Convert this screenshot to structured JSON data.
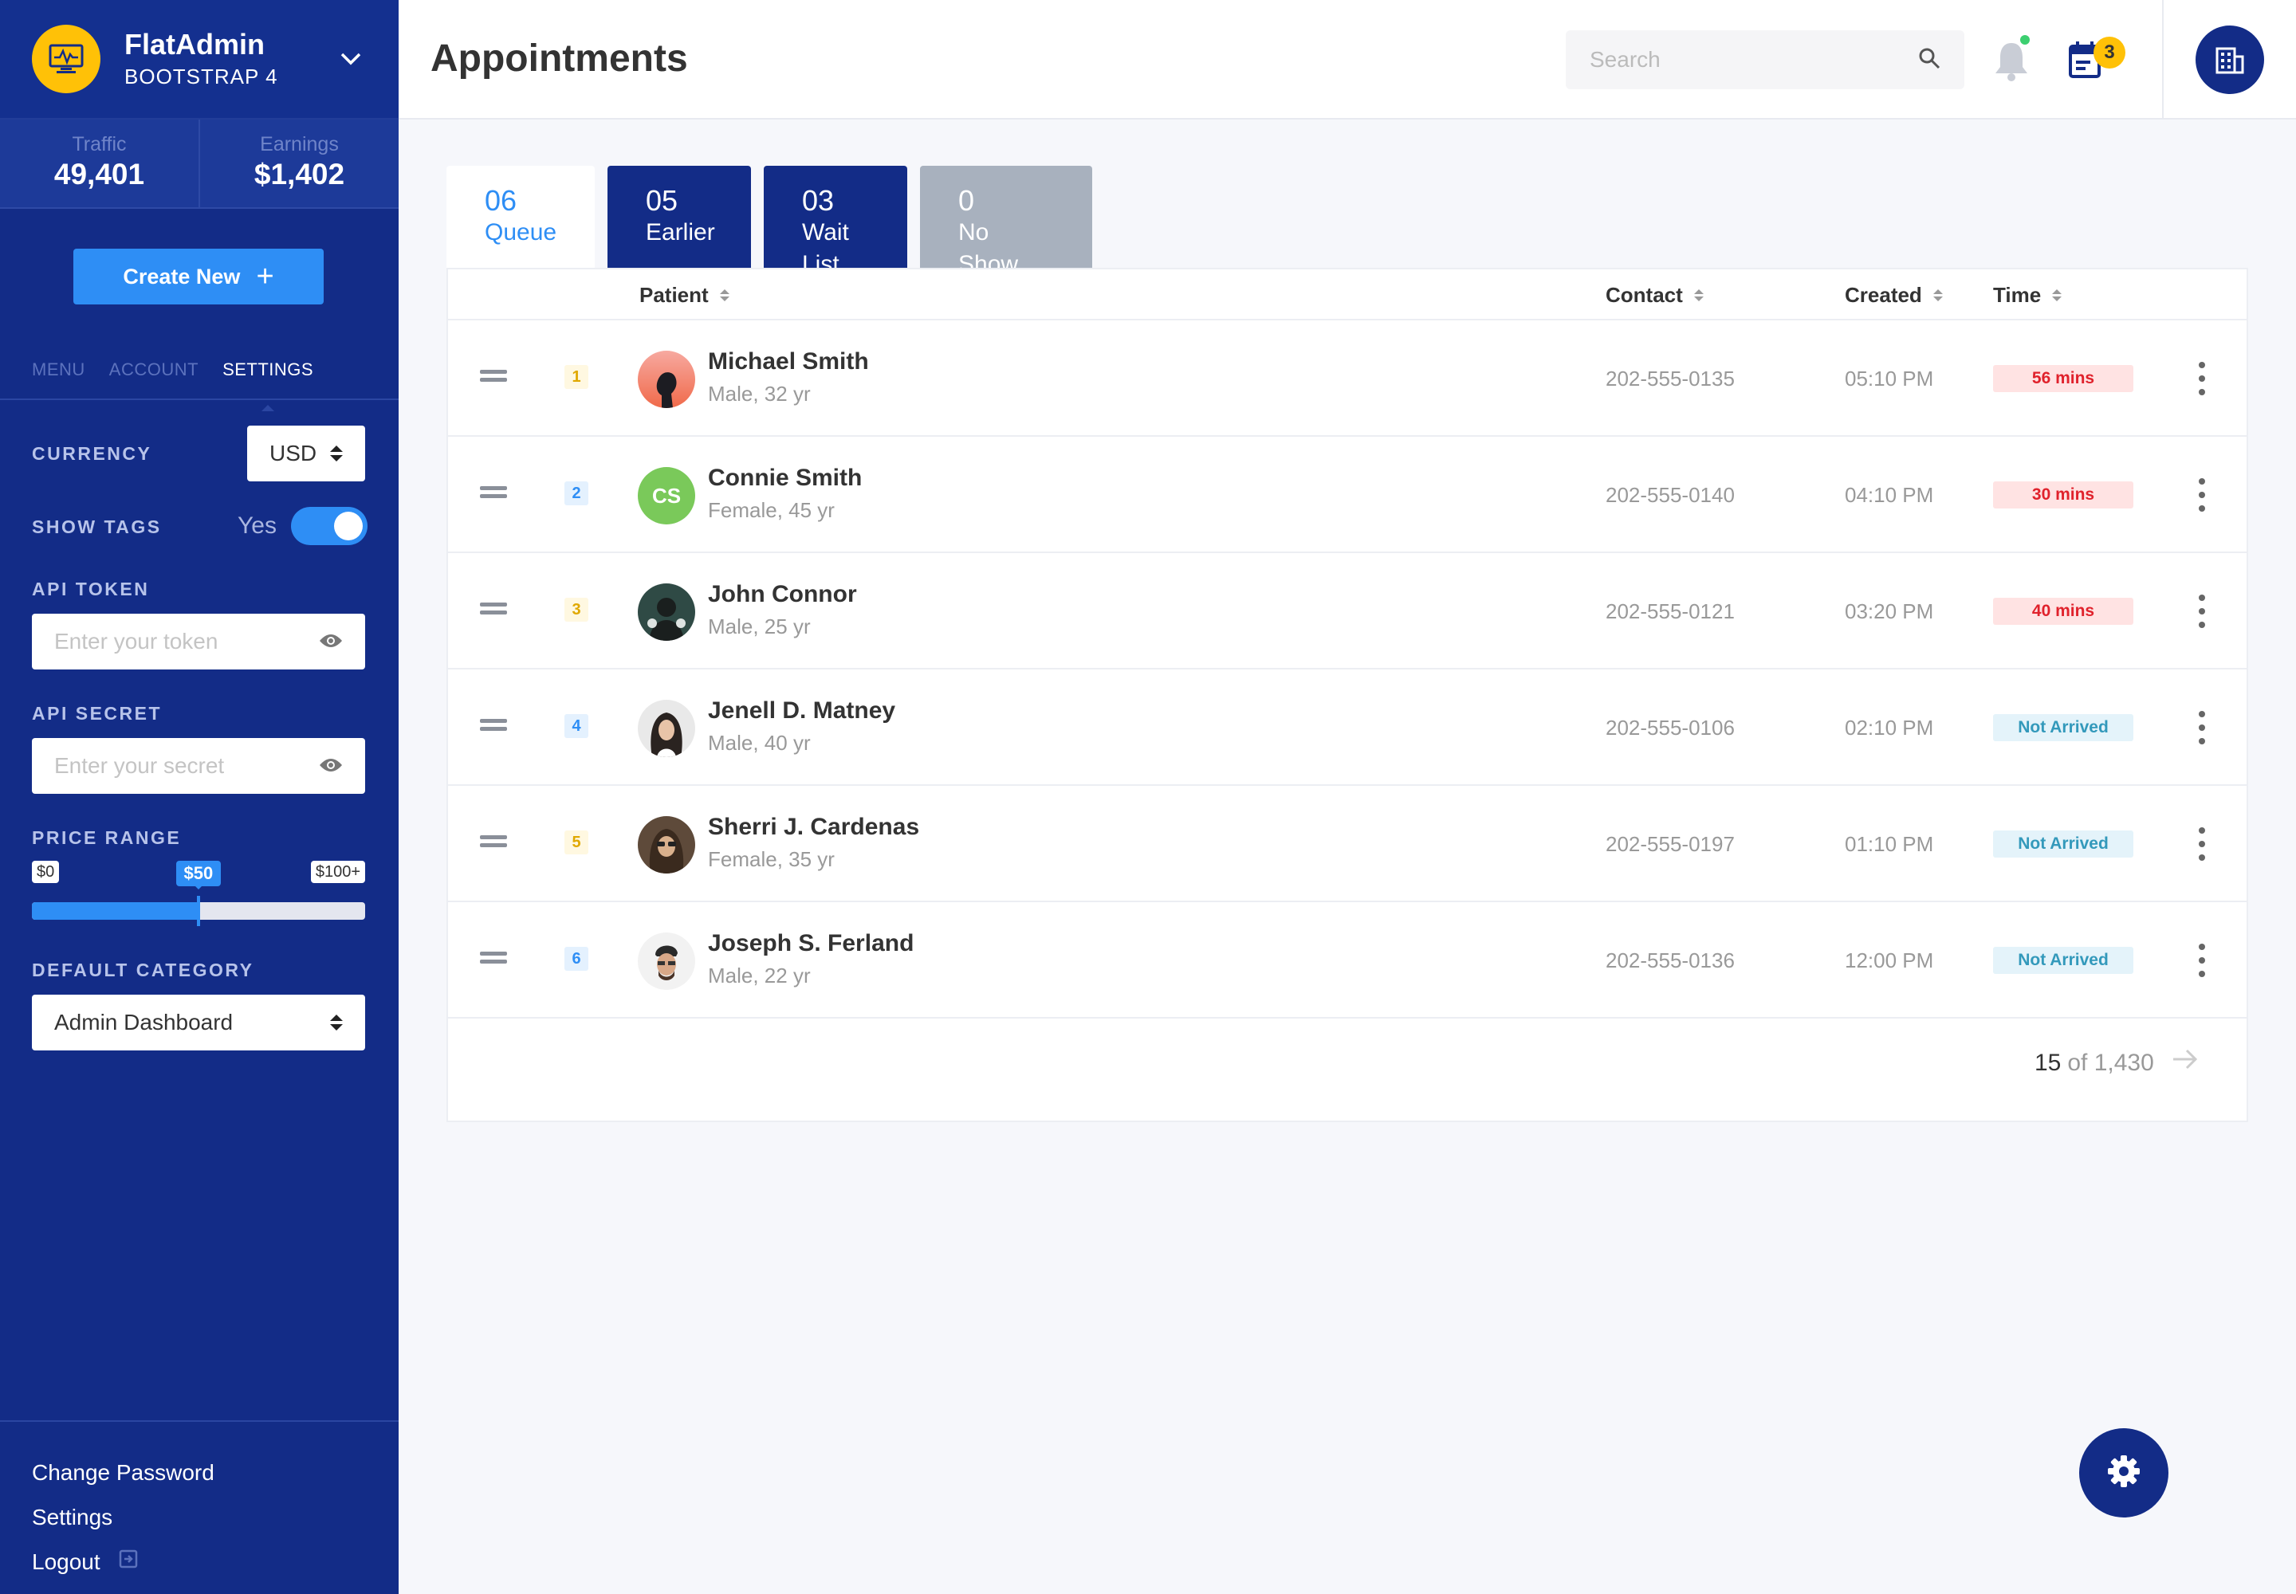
{
  "brand": {
    "name": "FlatAdmin",
    "subtitle": "BOOTSTRAP 4"
  },
  "stats": [
    {
      "label": "Traffic",
      "value": "49,401"
    },
    {
      "label": "Earnings",
      "value": "$1,402"
    }
  ],
  "sidebar": {
    "create_label": "Create New",
    "tabs": [
      "MENU",
      "ACCOUNT",
      "SETTINGS"
    ],
    "active_tab": "SETTINGS",
    "currency": {
      "label": "CURRENCY",
      "value": "USD"
    },
    "show_tags": {
      "label": "SHOW TAGS",
      "value": "Yes",
      "on": true
    },
    "api_token": {
      "label": "API TOKEN",
      "placeholder": "Enter your token"
    },
    "api_secret": {
      "label": "API SECRET",
      "placeholder": "Enter your secret"
    },
    "price_range": {
      "label": "PRICE RANGE",
      "min": "$0",
      "current": "$50",
      "max": "$100+",
      "fill_fraction": 0.5
    },
    "default_category": {
      "label": "DEFAULT CATEGORY",
      "value": "Admin Dashboard"
    },
    "bottom_links": [
      "Change Password",
      "Settings",
      "Logout"
    ]
  },
  "header": {
    "title": "Appointments",
    "search_placeholder": "Search",
    "notification_badge": "3"
  },
  "tabs": [
    {
      "num": "06",
      "label": "Queue"
    },
    {
      "num": "05",
      "label": "Earlier"
    },
    {
      "num": "03",
      "label": "Wait List"
    },
    {
      "num": "0",
      "label": "No Show"
    }
  ],
  "table": {
    "columns": [
      "Patient",
      "Contact",
      "Created",
      "Time"
    ],
    "rows": [
      {
        "rank": "1",
        "name": "Michael Smith",
        "info": "Male, 32 yr",
        "contact": "202-555-0135",
        "created": "05:10 PM",
        "time": "56 mins",
        "status": "late"
      },
      {
        "rank": "2",
        "name": "Connie Smith",
        "info": "Female, 45 yr",
        "initials": "CS",
        "contact": "202-555-0140",
        "created": "04:10 PM",
        "time": "30 mins",
        "status": "late"
      },
      {
        "rank": "3",
        "name": "John Connor",
        "info": "Male, 25 yr",
        "contact": "202-555-0121",
        "created": "03:20 PM",
        "time": "40 mins",
        "status": "late"
      },
      {
        "rank": "4",
        "name": "Jenell D. Matney",
        "info": "Male, 40 yr",
        "contact": "202-555-0106",
        "created": "02:10 PM",
        "time": "Not Arrived",
        "status": "na"
      },
      {
        "rank": "5",
        "name": "Sherri J. Cardenas",
        "info": "Female, 35 yr",
        "contact": "202-555-0197",
        "created": "01:10 PM",
        "time": "Not Arrived",
        "status": "na"
      },
      {
        "rank": "6",
        "name": "Joseph S. Ferland",
        "info": "Male, 22 yr",
        "contact": "202-555-0136",
        "created": "12:00 PM",
        "time": "Not Arrived",
        "status": "na"
      }
    ]
  },
  "pager": {
    "current": "15",
    "of_label": "of 1,430"
  },
  "colors": {
    "sidebar": "#132c87",
    "accent": "#2e8ef5",
    "warning": "#ffc107",
    "late": "#e0222c"
  }
}
